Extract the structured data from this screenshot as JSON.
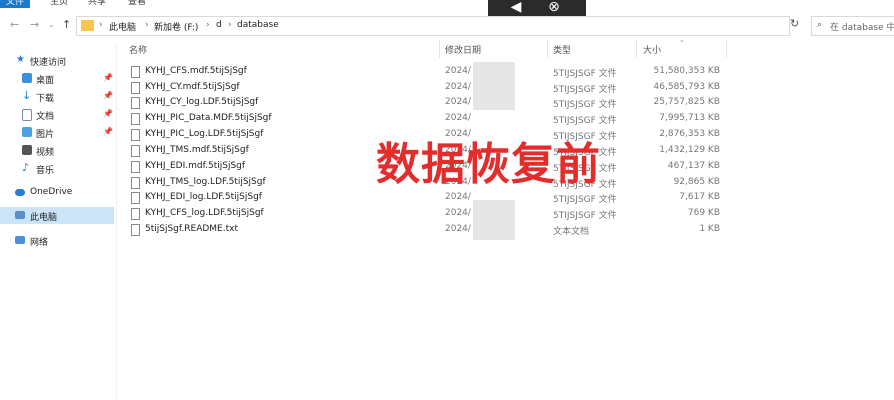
{
  "ribbon": {
    "tabs": [
      "文件",
      "主页",
      "共享",
      "查看"
    ]
  },
  "nav": {
    "back_icon": "←",
    "forward_icon": "→",
    "dropdown_icon": "⌄",
    "up_icon": "↑"
  },
  "address": {
    "crumbs": [
      "此电脑",
      "新加卷 (F:)",
      "d",
      "database"
    ],
    "separator": "›"
  },
  "search": {
    "placeholder": "在 database 中搜"
  },
  "sidebar": {
    "items": [
      {
        "label": "快速访问",
        "icon": "star-icon"
      },
      {
        "label": "桌面",
        "icon": "desktop-icon"
      },
      {
        "label": "下载",
        "icon": "download-icon"
      },
      {
        "label": "文档",
        "icon": "document-icon"
      },
      {
        "label": "图片",
        "icon": "pictures-icon"
      },
      {
        "label": "视频",
        "icon": "video-icon"
      },
      {
        "label": "音乐",
        "icon": "music-icon"
      },
      {
        "label": "OneDrive",
        "icon": "cloud-icon"
      },
      {
        "label": "此电脑",
        "icon": "computer-icon"
      },
      {
        "label": "网络",
        "icon": "network-icon"
      }
    ]
  },
  "columns": {
    "name": "名称",
    "date": "修改日期",
    "type": "类型",
    "size": "大小"
  },
  "files": [
    {
      "name": "KYHJ_CFS.mdf.5tijSjSgf",
      "date": "2024/",
      "type": "5TIJSJSGF 文件",
      "size": "51,580,353 KB"
    },
    {
      "name": "KYHJ_CY.mdf.5tijSjSgf",
      "date": "2024/",
      "type": "5TIJSJSGF 文件",
      "size": "46,585,793 KB"
    },
    {
      "name": "KYHJ_CY_log.LDF.5tijSjSgf",
      "date": "2024/",
      "type": "5TIJSJSGF 文件",
      "size": "25,757,825 KB"
    },
    {
      "name": "KYHJ_PIC_Data.MDF.5tijSjSgf",
      "date": "2024/",
      "type": "5TIJSJSGF 文件",
      "size": "7,995,713 KB"
    },
    {
      "name": "KYHJ_PIC_Log.LDF.5tijSjSgf",
      "date": "2024/",
      "type": "5TIJSJSGF 文件",
      "size": "2,876,353 KB"
    },
    {
      "name": "KYHJ_TMS.mdf.5tijSjSgf",
      "date": "2024/",
      "type": "5TIJSJSGF 文件",
      "size": "1,432,129 KB"
    },
    {
      "name": "KYHJ_EDI.mdf.5tijSjSgf",
      "date": "2024/",
      "type": "5TIJSJSGF 文件",
      "size": "467,137 KB"
    },
    {
      "name": "KYHJ_TMS_log.LDF.5tijSjSgf",
      "date": "2024/",
      "type": "5TIJSJSGF 文件",
      "size": "92,865 KB"
    },
    {
      "name": "KYHJ_EDI_log.LDF.5tijSjSgf",
      "date": "2024/",
      "type": "5TIJSJSGF 文件",
      "size": "7,617 KB"
    },
    {
      "name": "KYHJ_CFS_log.LDF.5tijSjSgf",
      "date": "2024/",
      "type": "5TIJSJSGF 文件",
      "size": "769 KB"
    },
    {
      "name": "5tijSjSgf.README.txt",
      "date": "2024/",
      "type": "文本文档",
      "size": "1 KB"
    }
  ],
  "overlay": {
    "caption": "数据恢复前",
    "color": "#e32d2d"
  },
  "media_controls": {
    "play_icon": "◀",
    "close_icon": "⊗"
  },
  "colors": {
    "selection": "#cce4f7",
    "accent": "#1979ca",
    "folder": "#f5c84a"
  }
}
